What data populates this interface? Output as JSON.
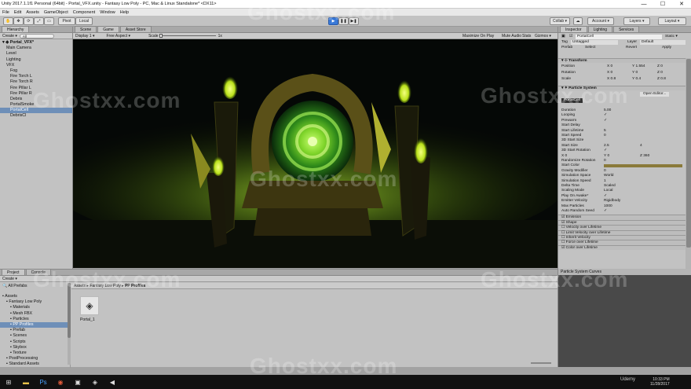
{
  "window": {
    "title": "Unity 2017.1.1f1 Personal (64bit) - Portal_VFX.unity - Fantasy Low Poly - PC, Mac & Linux Standalone* <DX11>",
    "min": "—",
    "max": "☐",
    "close": "✕"
  },
  "menu": [
    "File",
    "Edit",
    "Assets",
    "GameObject",
    "Component",
    "Window",
    "Help"
  ],
  "toolbar": {
    "pivot": "Pivot",
    "local": "Local",
    "play": "▶",
    "pause": "❚❚",
    "step": "▶❚",
    "collab": "Collab ▾",
    "account": "Account ▾",
    "layers": "Layers ▾",
    "layout": "Layout ▾"
  },
  "hierarchy": {
    "tab": "Hierarchy",
    "create": "Create ▾",
    "search_placeholder": "All",
    "scene": "Portal_VFX*",
    "items": [
      {
        "label": "Main Camera",
        "indent": 1
      },
      {
        "label": "Level",
        "indent": 1
      },
      {
        "label": "Lighting",
        "indent": 1
      },
      {
        "label": "VFX",
        "indent": 1
      },
      {
        "label": "Fog",
        "indent": 2
      },
      {
        "label": "Fire Torch L",
        "indent": 2
      },
      {
        "label": "Fire Torch R",
        "indent": 2
      },
      {
        "label": "Fire Pillar L",
        "indent": 2
      },
      {
        "label": "Fire Pillar R",
        "indent": 2
      },
      {
        "label": "Debris",
        "indent": 2
      },
      {
        "label": "PortalSmoke",
        "indent": 2
      },
      {
        "label": "PortalCell",
        "indent": 2,
        "selected": true
      },
      {
        "label": "DebrisCl",
        "indent": 2
      }
    ]
  },
  "view": {
    "tabs": [
      "Scene",
      "Game",
      "Asset Store"
    ],
    "display": "Display 1 ▾",
    "aspect": "Free Aspect ▾",
    "scale_label": "Scale",
    "scale_value": "1x",
    "maximize": "Maximize On Play",
    "mute": "Mute Audio",
    "stats": "Stats",
    "gizmos": "Gizmos ▾"
  },
  "inspector": {
    "tabs": [
      "Inspector",
      "Lighting",
      "Services"
    ],
    "object_name": "PortalCell",
    "static": "Static ▾",
    "tag_label": "Tag",
    "tag_value": "Untagged",
    "layer_label": "Layer",
    "layer_value": "Default",
    "prefab": "Prefab",
    "select": "Select",
    "revert": "Revert",
    "apply": "Apply",
    "transform": {
      "title": "Transform",
      "rows": [
        {
          "k": "Position",
          "x": "0",
          "y": "1.554",
          "z": "0"
        },
        {
          "k": "Rotation",
          "x": "0",
          "y": "0",
          "z": "0"
        },
        {
          "k": "Scale",
          "x": "0.8",
          "y": "0.4",
          "z": "0.8"
        }
      ]
    },
    "ps_title": "Particle System",
    "open_editor": "Open Editor...",
    "ps_name": "PortalCell",
    "props": [
      {
        "k": "Duration",
        "v": "5.00"
      },
      {
        "k": "Looping",
        "v": "✓"
      },
      {
        "k": "Prewarm",
        "v": "✓"
      },
      {
        "k": "Start Delay",
        "v": ""
      },
      {
        "k": "Start Lifetime",
        "v": "5"
      },
      {
        "k": "Start Speed",
        "v": "0"
      },
      {
        "k": "3D Start Size",
        "v": ""
      },
      {
        "k": "Start Size",
        "v": "2.5",
        "v2": "4"
      },
      {
        "k": "3D Start Rotation",
        "v": "✓"
      },
      {
        "k": "X 0",
        "v": "Y 0",
        "v2": "Z 360"
      },
      {
        "k": "Randomize Rotation",
        "v": "0"
      },
      {
        "k": "Start Color",
        "v": ""
      },
      {
        "k": "Gravity Modifier",
        "v": "0"
      },
      {
        "k": "Simulation Space",
        "v": "World"
      },
      {
        "k": "Simulation Speed",
        "v": "1"
      },
      {
        "k": "Delta Time",
        "v": "Scaled"
      },
      {
        "k": "Scaling Mode",
        "v": "Local"
      },
      {
        "k": "Play On Awake*",
        "v": "✓"
      },
      {
        "k": "Emitter Velocity",
        "v": "Rigidbody"
      },
      {
        "k": "Max Particles",
        "v": "1000"
      },
      {
        "k": "Auto Random Seed",
        "v": "✓"
      }
    ],
    "modules": [
      "Emission",
      "Shape",
      "Velocity over Lifetime",
      "Limit Velocity over Lifetime",
      "Inherit Velocity",
      "Force over Lifetime",
      "Color over Lifetime"
    ],
    "curves": "Particle System Curves"
  },
  "project": {
    "tabs": [
      "Project",
      "Console"
    ],
    "create": "Create ▾",
    "favorites": "All Prefabs",
    "breadcrumb": [
      "Assets",
      "Fantasy Low Poly",
      "PP Profiles"
    ],
    "tree": [
      {
        "label": "Assets",
        "indent": 0
      },
      {
        "label": "Fantasy Low Poly",
        "indent": 1
      },
      {
        "label": "Materials",
        "indent": 2
      },
      {
        "label": "Mesh FBX",
        "indent": 2
      },
      {
        "label": "Particles",
        "indent": 2
      },
      {
        "label": "PP Profiles",
        "indent": 2,
        "selected": true
      },
      {
        "label": "Prefab",
        "indent": 2
      },
      {
        "label": "Scenes",
        "indent": 2
      },
      {
        "label": "Scripts",
        "indent": 2
      },
      {
        "label": "Skybox",
        "indent": 2
      },
      {
        "label": "Texture",
        "indent": 2
      },
      {
        "label": "PostProcessing",
        "indent": 1
      },
      {
        "label": "Standard Assets",
        "indent": 1
      }
    ],
    "asset_name": "Portal_1"
  },
  "watermark": "Ghostxx.com",
  "taskbar": {
    "time": "10:33 PM",
    "date": "11/28/2017",
    "udemy": "Udemy"
  }
}
